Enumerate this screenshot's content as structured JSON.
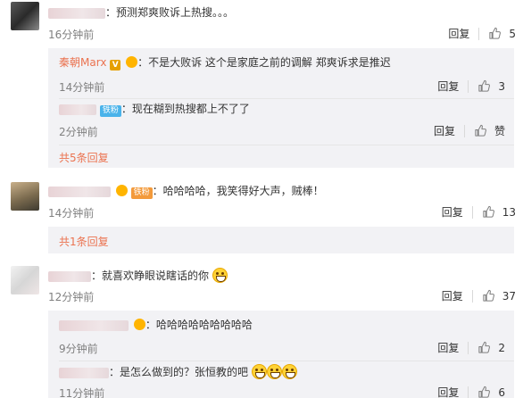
{
  "comments": [
    {
      "text": "：预测郑爽败诉上热搜。。。",
      "time": "16分钟前",
      "reply_label": "回复",
      "likes": "5"
    },
    {
      "text": "：哈哈哈哈，我笑得好大声，贼棒！",
      "time": "14分钟前",
      "reply_label": "回复",
      "likes": "13"
    },
    {
      "text": "：就喜欢睁眼说瞎话的你",
      "time": "12分钟前",
      "reply_label": "回复",
      "likes": "37"
    }
  ],
  "sub1": {
    "reply1": {
      "username": "秦朝Marx",
      "verified_badge": "V",
      "text": "：不是大败诉 这个是家庭之前的调解 郑爽诉求是推迟",
      "time": "14分钟前",
      "reply_label": "回复",
      "likes": "3"
    },
    "reply2": {
      "fan_badge": "铁粉",
      "text": "：现在糊到热搜都上不了了",
      "time": "2分钟前",
      "reply_label": "回复",
      "likes": "赞"
    },
    "more_label": "共5条回复"
  },
  "sub2": {
    "fan_badge": "铁粉",
    "more_label": "共1条回复"
  },
  "sub3": {
    "reply1": {
      "text": "：哈哈哈哈哈哈哈哈哈",
      "time": "9分钟前",
      "reply_label": "回复",
      "likes": "2"
    },
    "reply2": {
      "text": "：是怎么做到的？张恒教的吧",
      "time": "11分钟前",
      "reply_label": "回复",
      "likes": "6"
    }
  },
  "colors": {
    "accent": "#eb7350",
    "sub_bg": "#f2f2f5",
    "fan_badge_blue": "#4ab3ea",
    "fan_badge_orange": "#f39a3b",
    "vip_gold": "#e6a000"
  },
  "icons": {
    "like": "thumbs-up-icon",
    "laugh": "grinning-emoji-icon",
    "crown": "vip-crown-icon"
  }
}
